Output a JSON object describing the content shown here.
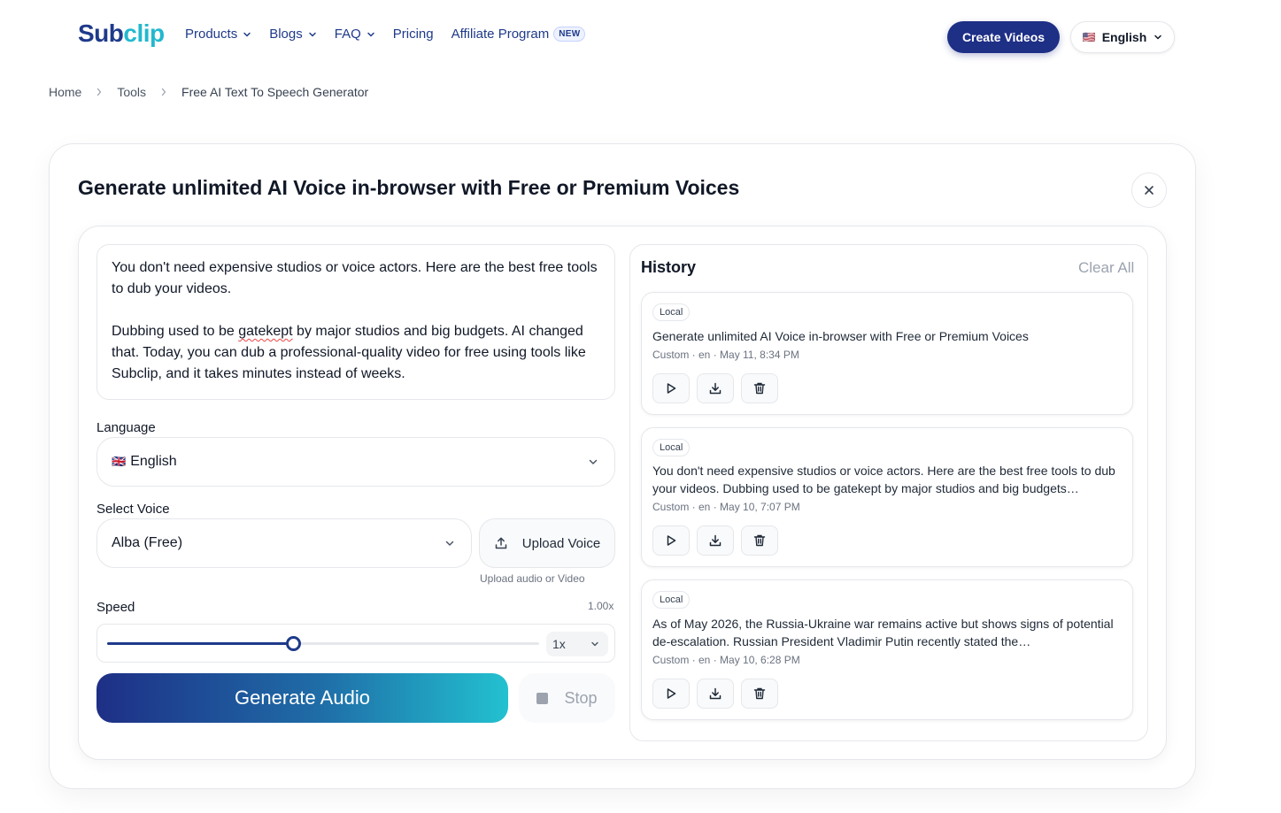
{
  "brand": {
    "part1": "Sub",
    "part2": "clip"
  },
  "nav": {
    "products": "Products",
    "blogs": "Blogs",
    "faq": "FAQ",
    "pricing": "Pricing",
    "affiliate": "Affiliate Program",
    "new_badge": "NEW",
    "create_videos": "Create Videos",
    "language": "English",
    "language_flag": "🇺🇸"
  },
  "breadcrumb": {
    "home": "Home",
    "tools": "Tools",
    "current": "Free AI Text To Speech Generator"
  },
  "page": {
    "title": "Generate unlimited AI Voice in-browser with Free or Premium Voices"
  },
  "editor": {
    "paragraph1": "You don't need expensive studios or voice actors. Here are the best free tools to dub your videos.",
    "paragraph2_before": "Dubbing used to be ",
    "paragraph2_misspelled": "gatekept",
    "paragraph2_after": " by major studios and big budgets. AI changed that. Today, you can dub a professional-quality video for free using tools like Subclip, and it takes minutes instead of weeks."
  },
  "language": {
    "label": "Language",
    "flag": "🇬🇧",
    "value": "English"
  },
  "voice": {
    "label": "Select Voice",
    "value": "Alba (Free)",
    "upload_label": "Upload Voice",
    "upload_hint": "Upload audio or Video"
  },
  "speed": {
    "label": "Speed",
    "value_text": "1.00x",
    "select_value": "1x",
    "slider_fraction": 0.43
  },
  "actions": {
    "generate": "Generate Audio",
    "stop": "Stop"
  },
  "history": {
    "title": "History",
    "clear_all": "Clear All",
    "items": [
      {
        "tag": "Local",
        "text": "Generate unlimited AI Voice in-browser with Free or Premium Voices",
        "meta": "Custom · en · May 11, 8:34 PM"
      },
      {
        "tag": "Local",
        "text": "You don't need expensive studios or voice actors. Here are the best free tools to dub your videos. Dubbing used to be gatekept by major studios and big budgets…",
        "meta": "Custom · en · May 10, 7:07 PM"
      },
      {
        "tag": "Local",
        "text": "As of May 2026, the Russia-Ukraine war remains active but shows signs of potential de-escalation. Russian President Vladimir Putin recently stated the…",
        "meta": "Custom · en · May 10, 6:28 PM"
      }
    ]
  },
  "colors": {
    "brand_navy": "#1e2f86",
    "brand_cyan": "#22c1d0",
    "border": "#e5e7eb"
  }
}
